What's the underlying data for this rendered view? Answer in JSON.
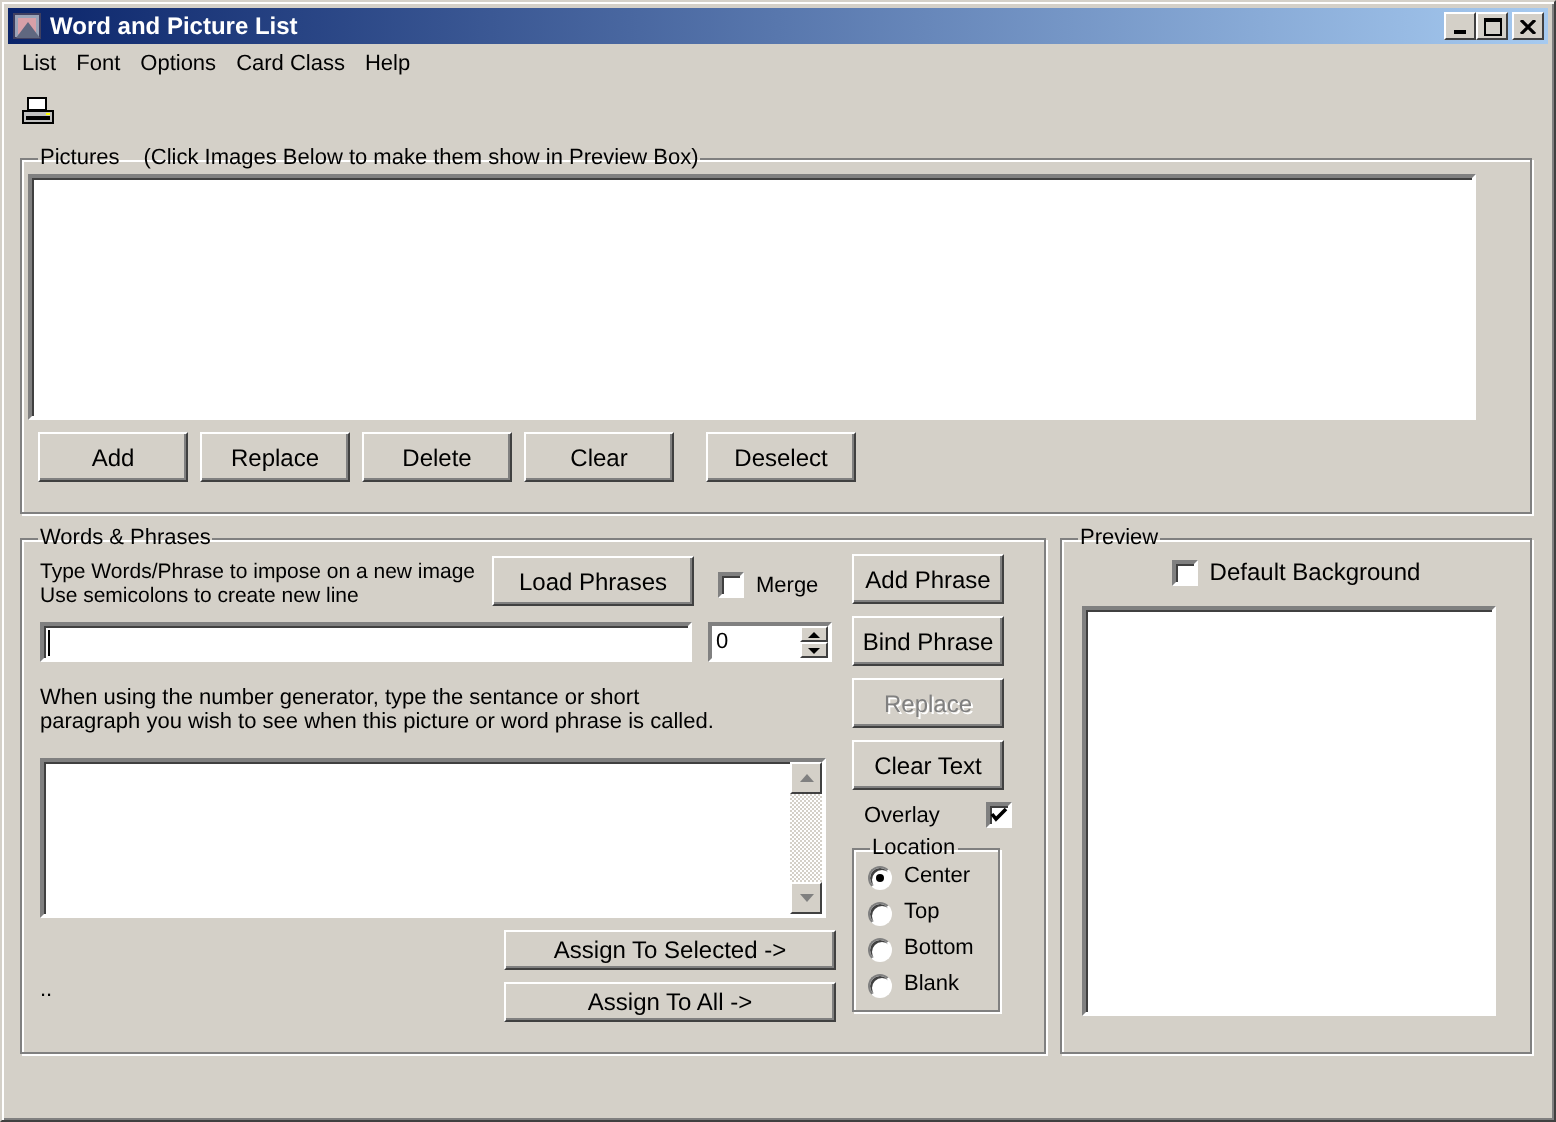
{
  "window": {
    "title": "Word and Picture List"
  },
  "menu": [
    "List",
    "Font",
    "Options",
    "Card Class",
    "Help"
  ],
  "pictures": {
    "legend": "Pictures",
    "hint": "(Click Images Below to make them show in Preview Box)",
    "buttons": [
      "Add",
      "Replace",
      "Delete",
      "Clear",
      "Deselect"
    ]
  },
  "words": {
    "legend": "Words & Phrases",
    "instructions": [
      "Type Words/Phrase to impose on a new image",
      "Use semicolons to create new line"
    ],
    "load_button": "Load Phrases",
    "merge": {
      "label": "Merge",
      "checked": false
    },
    "number_value": "0",
    "generator_note": [
      "When using the number generator, type the sentance or short",
      "paragraph you wish to see when this picture or word phrase is called."
    ],
    "assign_buttons": [
      "Assign To Selected ->",
      "Assign To All ->"
    ],
    "status": "..",
    "actions": [
      {
        "label": "Add Phrase",
        "disabled": false
      },
      {
        "label": "Bind Phrase",
        "disabled": false
      },
      {
        "label": "Replace",
        "disabled": true
      },
      {
        "label": "Clear Text",
        "disabled": false
      }
    ],
    "overlay": {
      "label": "Overlay",
      "checked": true
    },
    "location": {
      "legend": "Location",
      "options": [
        {
          "label": "Center",
          "selected": true
        },
        {
          "label": "Top",
          "selected": false
        },
        {
          "label": "Bottom",
          "selected": false
        },
        {
          "label": "Blank",
          "selected": false
        }
      ]
    }
  },
  "preview": {
    "legend": "Preview",
    "default_background": {
      "label": "Default Background",
      "checked": false
    }
  }
}
